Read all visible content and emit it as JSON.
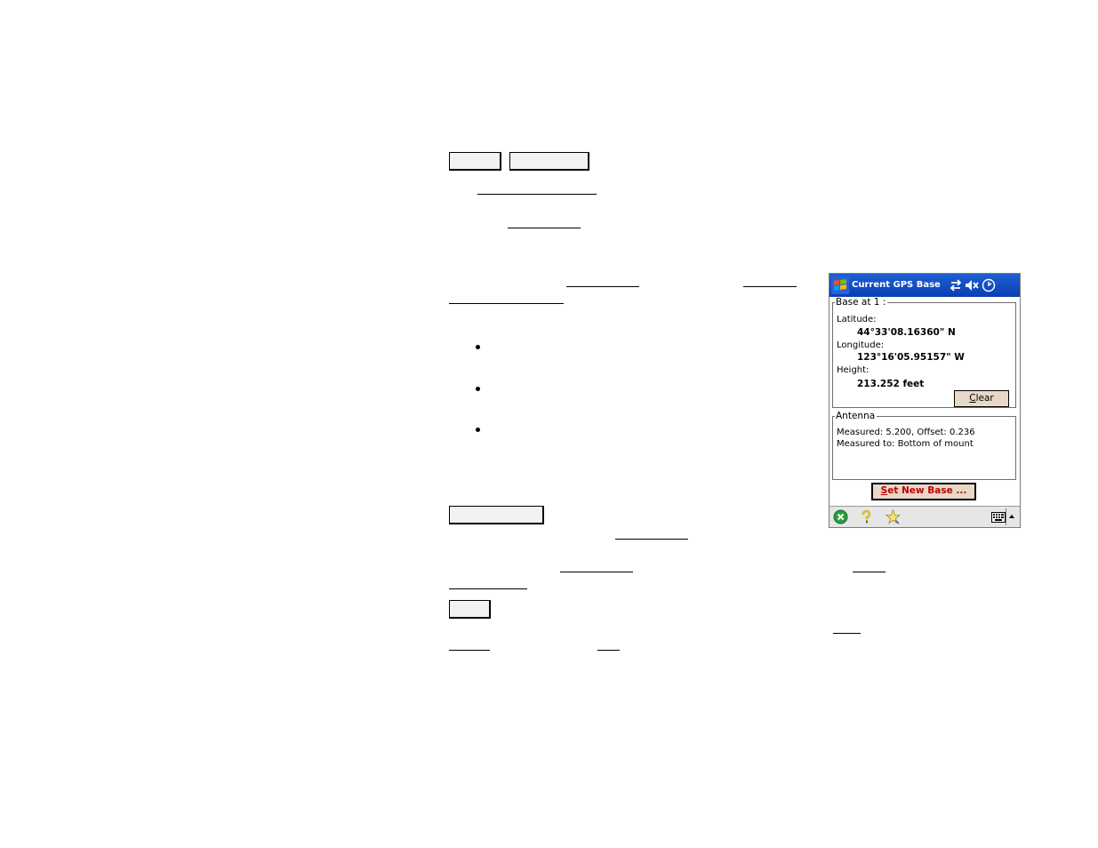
{
  "window": {
    "title": "Current GPS Base"
  },
  "base_group": {
    "legend": "Base at 1 :",
    "latitude_label": "Latitude:",
    "latitude_value": "44°33'08.16360\" N",
    "longitude_label": "Longitude:",
    "longitude_value": "123°16'05.95157\" W",
    "height_label": "Height:",
    "height_value": "213.252 feet",
    "clear_label": "Clear"
  },
  "antenna_group": {
    "legend": "Antenna",
    "measured_line": "Measured: 5.200, Offset: 0.236",
    "measured_to_line": "Measured to: Bottom of mount"
  },
  "actions": {
    "set_new_base_label": "Set New Base ..."
  },
  "icons": {
    "start": "windows-flag-icon",
    "connectivity": "connectivity-arrows-icon",
    "volume": "speaker-muted-icon",
    "clock": "clock-icon",
    "close": "close-circle-icon",
    "help": "help-pin-icon",
    "favorites": "star-icon",
    "keyboard": "keyboard-icon"
  },
  "colors": {
    "titlebar": "#0b3fb3",
    "button_face": "#e8d8c8",
    "set_base_text": "#c00000",
    "close_icon": "#2a9d3a"
  }
}
